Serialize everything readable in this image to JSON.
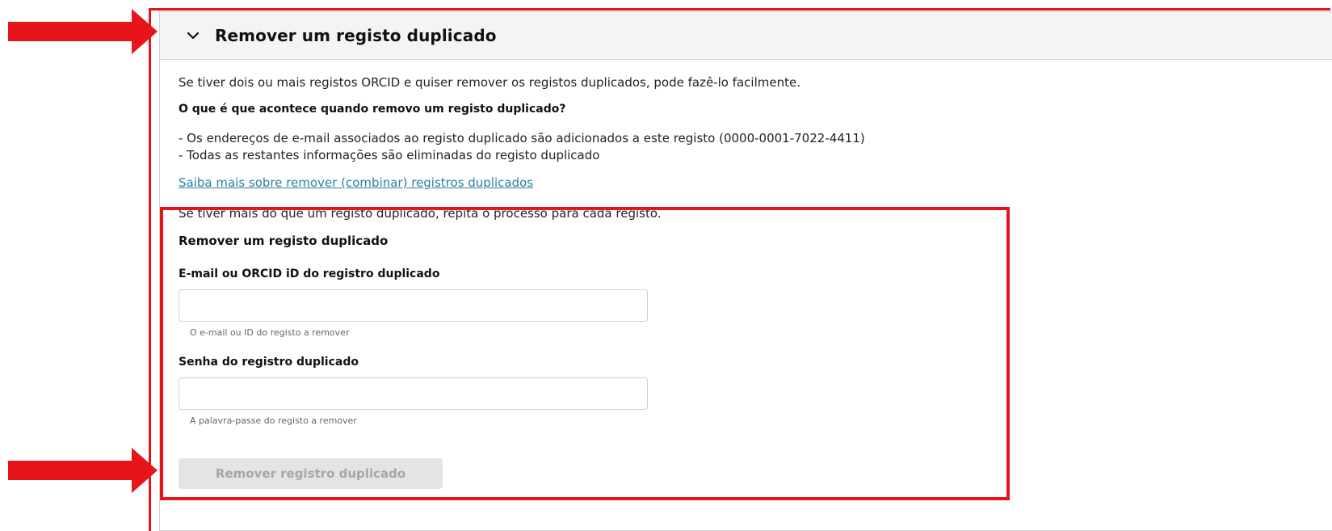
{
  "panel": {
    "title": "Remover um registo duplicado",
    "expanded": true,
    "intro": "Se tiver dois ou mais registos ORCID e quiser remover os registos duplicados, pode fazê-lo facilmente.",
    "question": "O que é que acontece quando removo um registo duplicado?",
    "bullets": [
      "- Os endereços de e-mail associados ao registo duplicado são adicionados a este registo (0000-0001-7022-4411)",
      "- Todas as restantes informações são eliminadas do registo duplicado"
    ],
    "learn_more_link": "Saiba mais sobre remover (combinar) registros duplicados",
    "repeat_note": "Se tiver mais do que um registo duplicado, repita o processo para cada registo."
  },
  "form": {
    "title": "Remover um registo duplicado",
    "email_label": "E-mail ou ORCID iD do registro duplicado",
    "email_value": "",
    "email_hint": "O e-mail ou ID do registo a remover",
    "password_label": "Senha do registro duplicado",
    "password_value": "",
    "password_hint": "A palavra-passe do registo a remover",
    "submit_label": "Remover registro duplicado",
    "submit_disabled": true
  },
  "colors": {
    "annotation_red": "#e8141b",
    "link": "#2e7f9f",
    "header_bg": "#f4f4f4",
    "button_disabled_bg": "#e4e4e4",
    "button_disabled_text": "#a6a6a6"
  },
  "icons": {
    "header_toggle": "chevron-down-icon",
    "annotations": [
      "red-arrow-icon",
      "red-arrow-icon"
    ]
  }
}
